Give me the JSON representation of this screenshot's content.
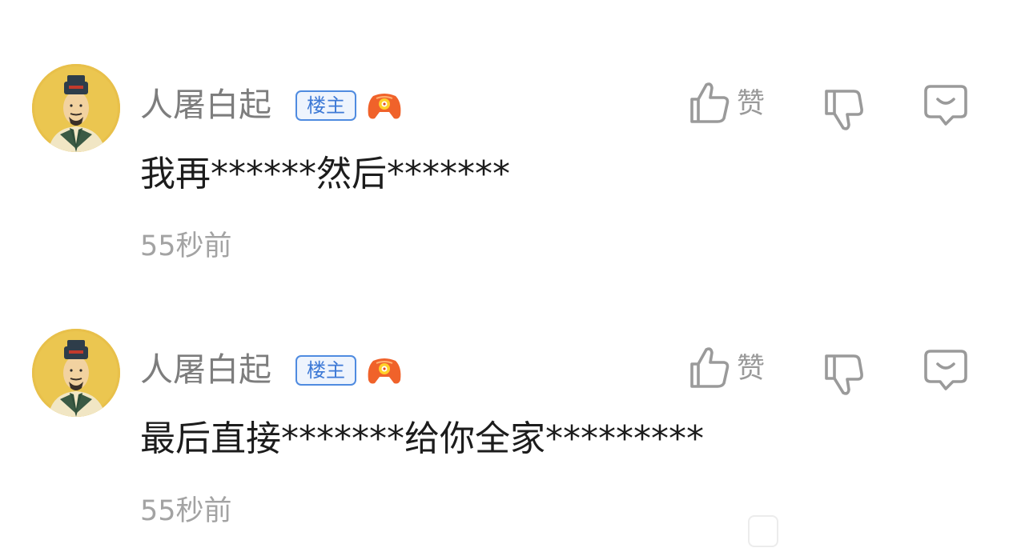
{
  "comments": [
    {
      "username": "人屠白起",
      "badge": "楼主",
      "text": "我再******然后*******",
      "time": "55秒前",
      "like_label": "赞"
    },
    {
      "username": "人屠白起",
      "badge": "楼主",
      "text": "最后直接*******给你全家*********",
      "time": "55秒前",
      "like_label": "赞"
    }
  ],
  "colors": {
    "username": "#7d7d7d",
    "badge_border": "#4f8be0",
    "badge_text": "#3d79d6",
    "comment_text": "#1c1c1c",
    "timestamp": "#a3a3a3",
    "icon_stroke": "#9a9a9a",
    "level_icon": "#f0622a"
  },
  "icons": {
    "like": "thumbs-up-icon",
    "dislike": "thumbs-down-icon",
    "reply": "reply-bubble-icon",
    "level": "game-controller-icon"
  }
}
